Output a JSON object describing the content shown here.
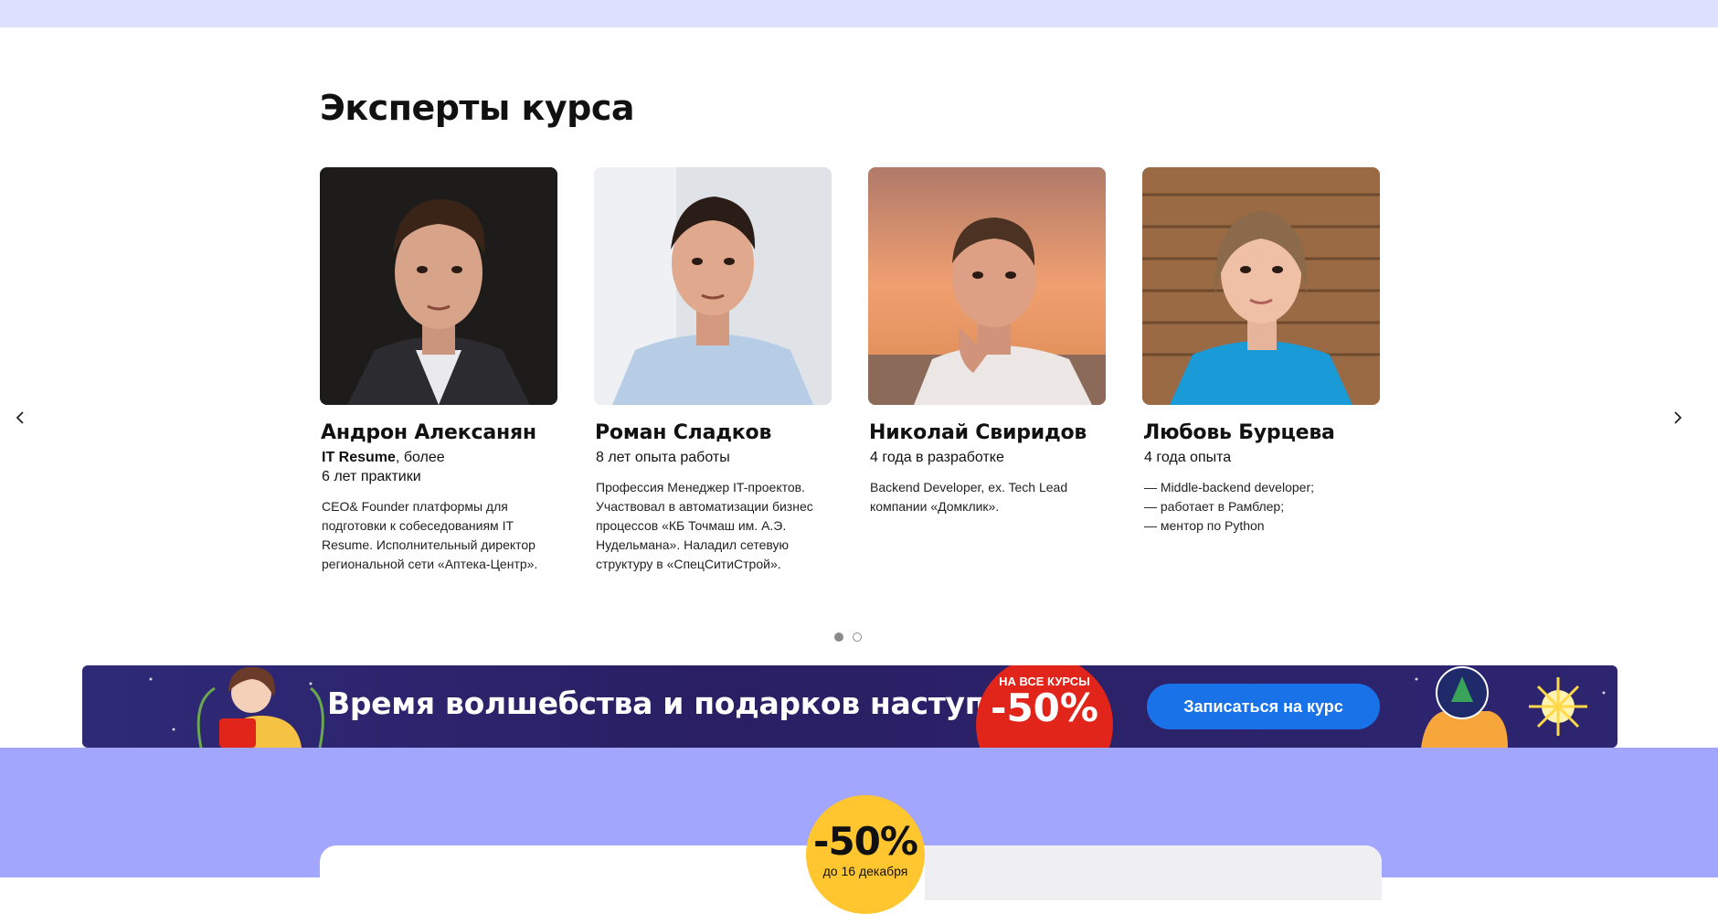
{
  "section": {
    "title": "Эксперты курса"
  },
  "experts": [
    {
      "name": "Андрон Алексанян",
      "exp_bold": "IT Resume",
      "exp_rest": ", более",
      "exp_line2": "6 лет практики",
      "desc": [
        "CEO& Founder платформы для",
        "подготовки к собеседованиям IT",
        "Resume. Исполнительный директор",
        "региональной сети «Аптека-Центр»."
      ]
    },
    {
      "name": "Роман Сладков",
      "exp": "8 лет опыта работы",
      "desc": [
        "Профессия Менеджер IT-проектов.",
        "Участвовал в автоматизации бизнес",
        "процессов «КБ Точмаш им. А.Э.",
        "Нудельмана». Наладил сетевую",
        "структуру в «СпецСитиСтрой»."
      ]
    },
    {
      "name": "Николай Свиридов",
      "exp": "4 года в разработке",
      "desc": [
        "Backend Developer, ex. Tech Lead",
        "компании «Домклик»."
      ]
    },
    {
      "name": "Любовь Бурцева",
      "exp": "4 года опыта",
      "desc": [
        "— Middle-backend developer;",
        "— работает в Рамблер;",
        "— ментор по Python"
      ]
    }
  ],
  "carousel": {
    "pages": 2,
    "active_page": 1,
    "prev_icon": "chevron-left-icon",
    "next_icon": "chevron-right-icon"
  },
  "promo": {
    "text": "Время волшебства и подарков наступило!",
    "badge_small": "НА ВСЕ КУРСЫ",
    "badge_big": "-50%",
    "cta": "Записаться на курс"
  },
  "price": {
    "discount": "-50%",
    "until": "до 16 декабря"
  },
  "colors": {
    "top_strip": "#dee0ff",
    "banner_bg": "#2a1f64",
    "badge_red": "#e1251b",
    "cta_blue": "#1a72e8",
    "purple_section": "#a2a6fc",
    "discount_yellow": "#ffc62f"
  }
}
